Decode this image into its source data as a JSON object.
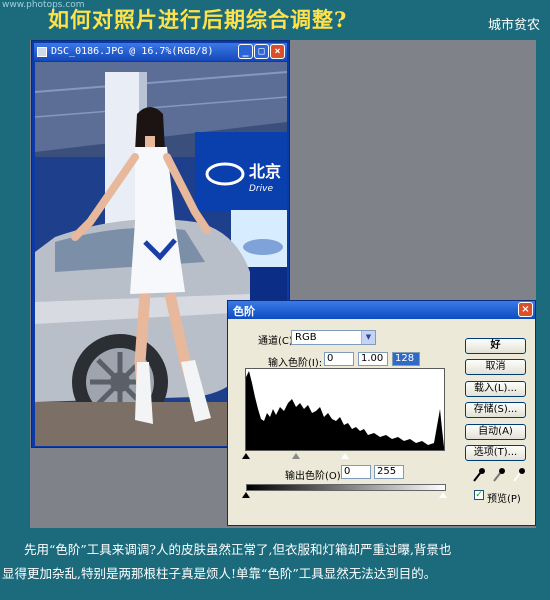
{
  "watermark": "www.photops.com",
  "page_title": "如何对照片进行后期综合调整?",
  "author": "城市贫农",
  "image_window": {
    "title": "DSC_0186.JPG @ 16.7%(RGB/8)",
    "min_symbol": "_",
    "max_symbol": "□",
    "close_symbol": "×",
    "sign_text": "北京",
    "brand_text": "Drive"
  },
  "levels_dialog": {
    "title": "色阶",
    "close_symbol": "×",
    "channel_label": "通道(C):",
    "channel_value": "RGB",
    "input_label": "输入色阶(I):",
    "input_values": [
      "0",
      "1.00",
      "128"
    ],
    "output_label": "输出色阶(O):",
    "output_values": [
      "0",
      "255"
    ],
    "buttons": [
      "好",
      "取消",
      "载入(L)...",
      "存储(S)...",
      "自动(A)",
      "选项(T)..."
    ],
    "preview_label": "预览(P)",
    "preview_checked": true
  },
  "caption": {
    "line1": "先用“色阶”工具来调调?人的皮肤虽然正常了,但衣服和灯箱却严重过曝,背景也",
    "line2": "显得更加杂乱,特别是两那根柱子真是烦人!单靠“色阶”工具显然无法达到目的。"
  },
  "colors": {
    "background": "#1b6b7d",
    "title": "#ffe24a",
    "workspace": "#7f8389"
  }
}
